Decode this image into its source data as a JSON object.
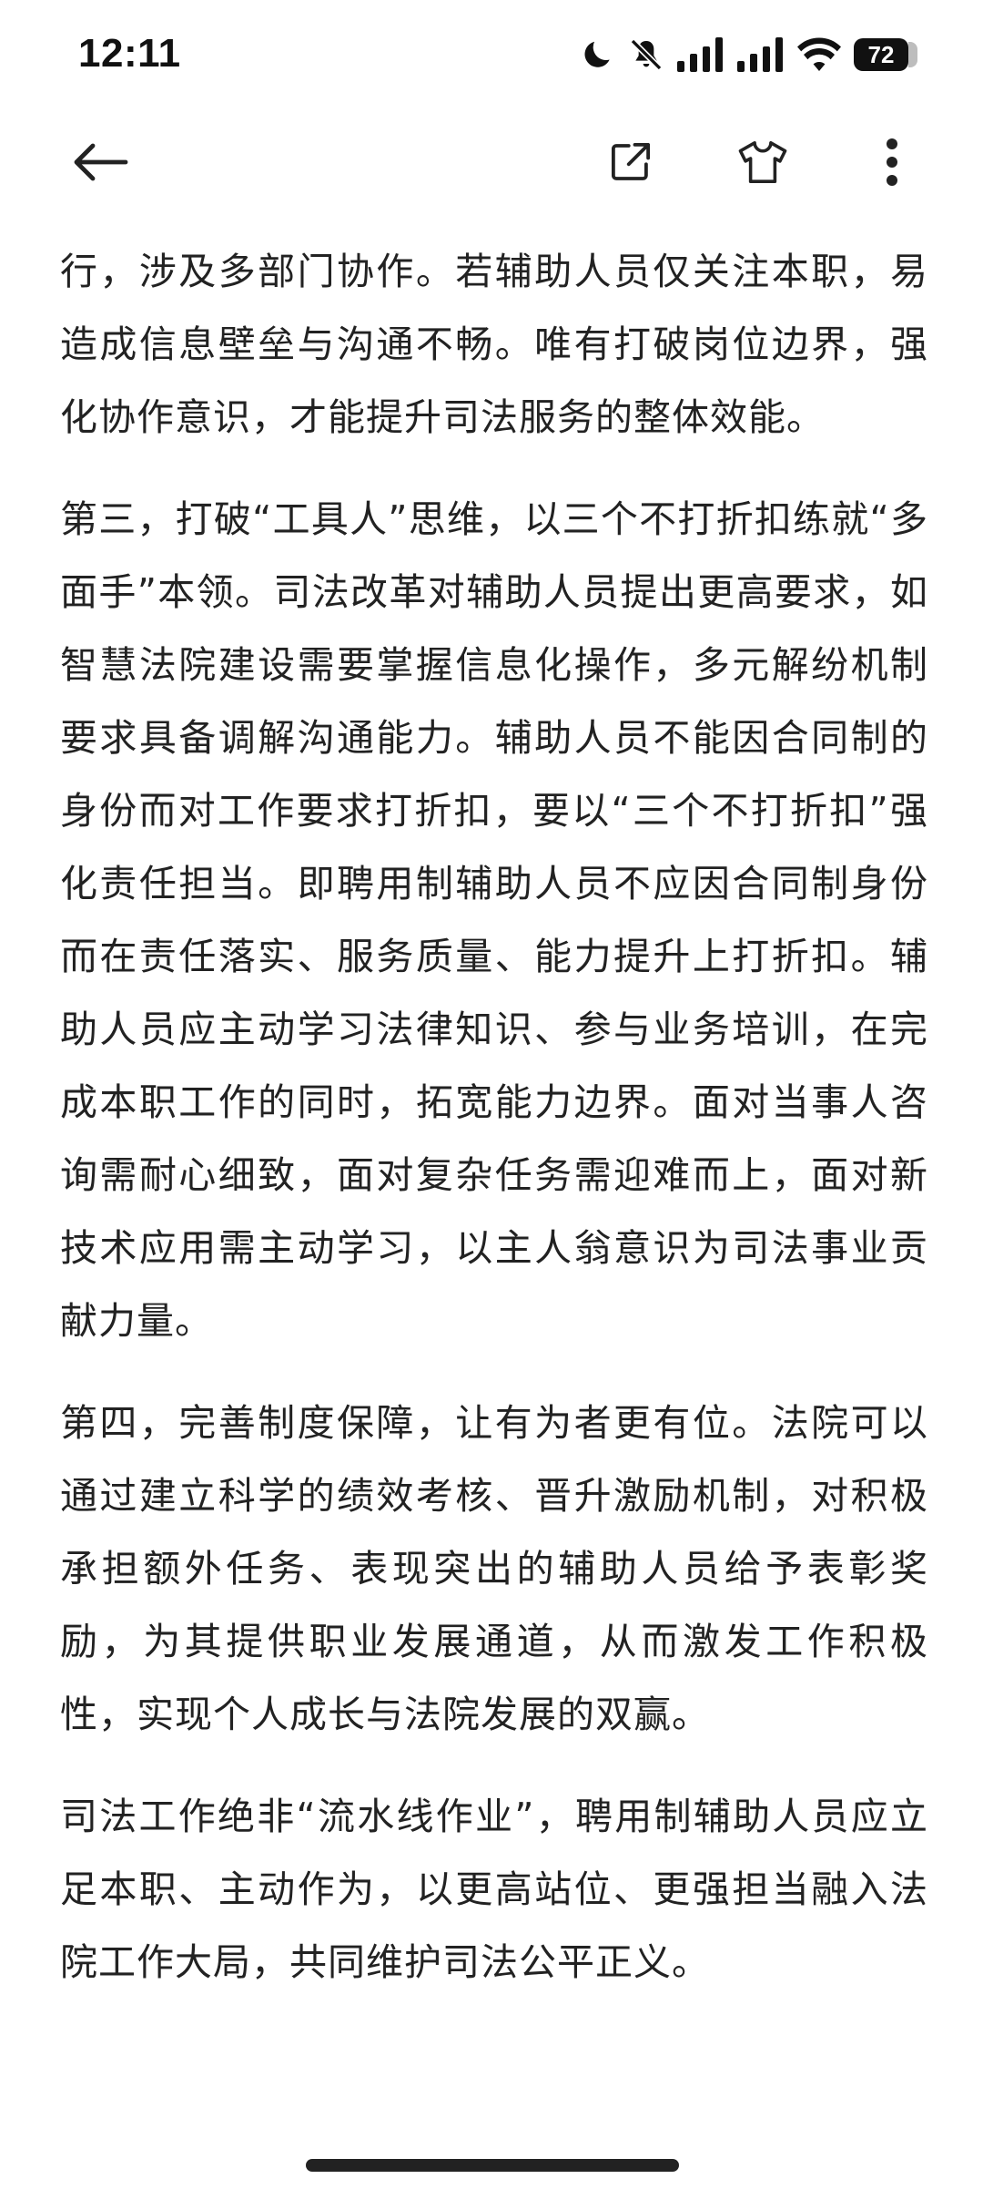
{
  "status_bar": {
    "time": "12:11",
    "battery": "72",
    "icons": [
      "moon-icon",
      "bell-off-icon",
      "signal-icon",
      "signal-icon",
      "wifi-icon",
      "battery-icon"
    ]
  },
  "app_bar": {
    "icons": [
      "back-arrow-icon",
      "share-icon",
      "tshirt-icon",
      "more-vertical-icon"
    ]
  },
  "article": {
    "paragraphs": [
      "行，涉及多部门协作。若辅助人员仅关注本职，易造成信息壁垒与沟通不畅。唯有打破岗位边界，强化协作意识，才能提升司法服务的整体效能。",
      "第三，打破“工具人”思维，以三个不打折扣练就“多面手”本领。司法改革对辅助人员提出更高要求，如智慧法院建设需要掌握信息化操作，多元解纷机制要求具备调解沟通能力。辅助人员不能因合同制的身份而对工作要求打折扣，要以“三个不打折扣”强化责任担当。即聘用制辅助人员不应因合同制身份而在责任落实、服务质量、能力提升上打折扣。辅助人员应主动学习法律知识、参与业务培训，在完成本职工作的同时，拓宽能力边界。面对当事人咨询需耐心细致，面对复杂任务需迎难而上，面对新技术应用需主动学习，以主人翁意识为司法事业贡献力量。",
      "第四，完善制度保障，让有为者更有位。法院可以通过建立科学的绩效考核、晋升激励机制，对积极承担额外任务、表现突出的辅助人员给予表彰奖励，为其提供职业发展通道，从而激发工作积极性，实现个人成长与法院发展的双赢。",
      "司法工作绝非“流水线作业”，聘用制辅助人员应立足本职、主动作为，以更高站位、更强担当融入法院工作大局，共同维护司法公平正义。"
    ]
  }
}
